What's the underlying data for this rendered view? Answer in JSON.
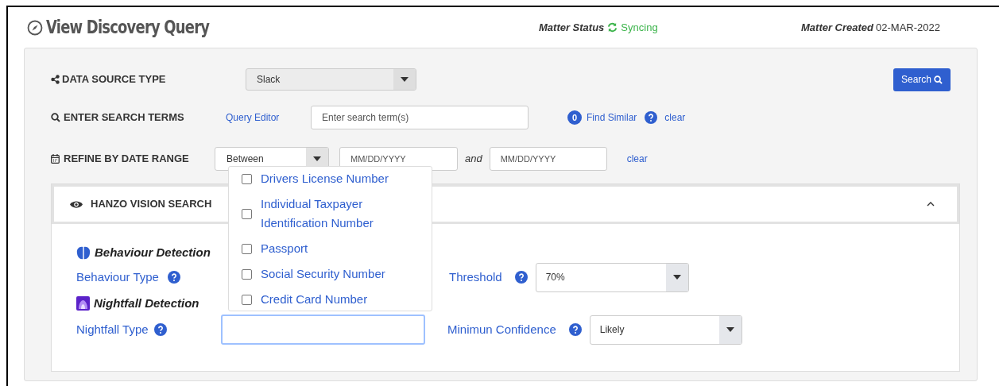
{
  "page": {
    "title": "View Discovery Query",
    "matter_status_label": "Matter Status",
    "matter_status": "Syncing",
    "matter_created_label": "Matter Created",
    "matter_created": "02-MAR-2022"
  },
  "query": {
    "data_source_label": "DATA SOURCE TYPE",
    "data_source": "Slack",
    "search_button": "Search",
    "search_terms_label": "ENTER SEARCH TERMS",
    "query_editor_link": "Query Editor",
    "search_placeholder": "Enter search term(s)",
    "similar_count": "0",
    "find_similar_link": "Find Similar",
    "clear_terms_link": "clear",
    "date_label": "REFINE BY DATE RANGE",
    "date_mode": "Between",
    "date_from_placeholder": "MM/DD/YYYY",
    "date_joiner": "and",
    "date_to_placeholder": "MM/DD/YYYY",
    "clear_dates_link": "clear"
  },
  "vision": {
    "title": "HANZO VISION SEARCH",
    "expanded": true,
    "behaviour_title": "Behaviour Detection",
    "behaviour_type_label": "Behaviour Type",
    "threshold_label": "Threshold",
    "threshold": "70%",
    "nightfall_title": "Nightfall Detection",
    "nightfall_type_label": "Nightfall Type",
    "confidence_label": "Minimun Confidence",
    "confidence": "Likely",
    "nightfall_options": [
      {
        "label": "Drivers License Number",
        "checked": false
      },
      {
        "label": "Individual Taxpayer Identification Number",
        "checked": false
      },
      {
        "label": "Passport",
        "checked": false
      },
      {
        "label": "Social Security Number",
        "checked": false
      },
      {
        "label": "Credit Card Number",
        "checked": false
      }
    ]
  }
}
